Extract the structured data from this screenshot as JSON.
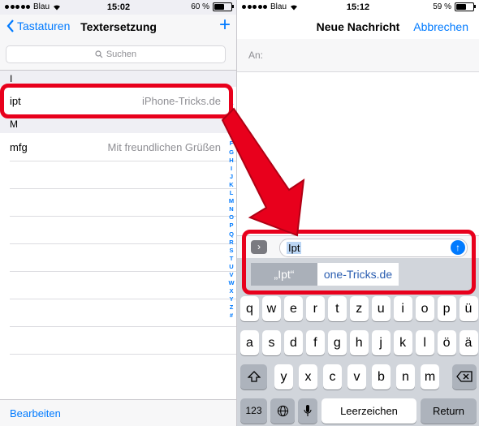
{
  "left_screen": {
    "status": {
      "carrier": "Blau",
      "time": "15:02",
      "battery": "60 %",
      "battery_level": 0.6
    },
    "nav": {
      "back_label": "Tastaturen",
      "title": "Textersetzung",
      "add_label": "+"
    },
    "search": {
      "placeholder": "Suchen"
    },
    "sections": [
      {
        "header": "I",
        "rows": [
          {
            "phrase": "ipt",
            "replacement": "iPhone-Tricks.de"
          }
        ]
      },
      {
        "header": "M",
        "rows": [
          {
            "phrase": "mfg",
            "replacement": "Mit freundlichen Grüßen"
          }
        ]
      }
    ],
    "index_letters": [
      "A",
      "B",
      "C",
      "D",
      "E",
      "F",
      "G",
      "H",
      "I",
      "J",
      "K",
      "L",
      "M",
      "N",
      "O",
      "P",
      "Q",
      "R",
      "S",
      "T",
      "U",
      "V",
      "W",
      "X",
      "Y",
      "Z",
      "#"
    ],
    "bottom": {
      "edit_label": "Bearbeiten"
    }
  },
  "right_screen": {
    "status": {
      "carrier": "Blau",
      "time": "15:12",
      "battery": "59 %",
      "battery_level": 0.59
    },
    "nav": {
      "title": "Neue Nachricht",
      "cancel_label": "Abbrechen"
    },
    "to_label": "An:",
    "message_text": "Ipt",
    "suggestions": [
      "„Ipt“",
      "one-Tricks.de"
    ],
    "keyboard": {
      "row1": [
        "q",
        "w",
        "e",
        "r",
        "t",
        "z",
        "u",
        "i",
        "o",
        "p",
        "ü"
      ],
      "row2": [
        "a",
        "s",
        "d",
        "f",
        "g",
        "h",
        "j",
        "k",
        "l",
        "ö",
        "ä"
      ],
      "row3": [
        "y",
        "x",
        "c",
        "v",
        "b",
        "n",
        "m"
      ],
      "numbers_label": "123",
      "space_label": "Leerzeichen",
      "return_label": "Return"
    }
  },
  "colors": {
    "accent": "#007aff",
    "highlight": "#e8001c"
  }
}
